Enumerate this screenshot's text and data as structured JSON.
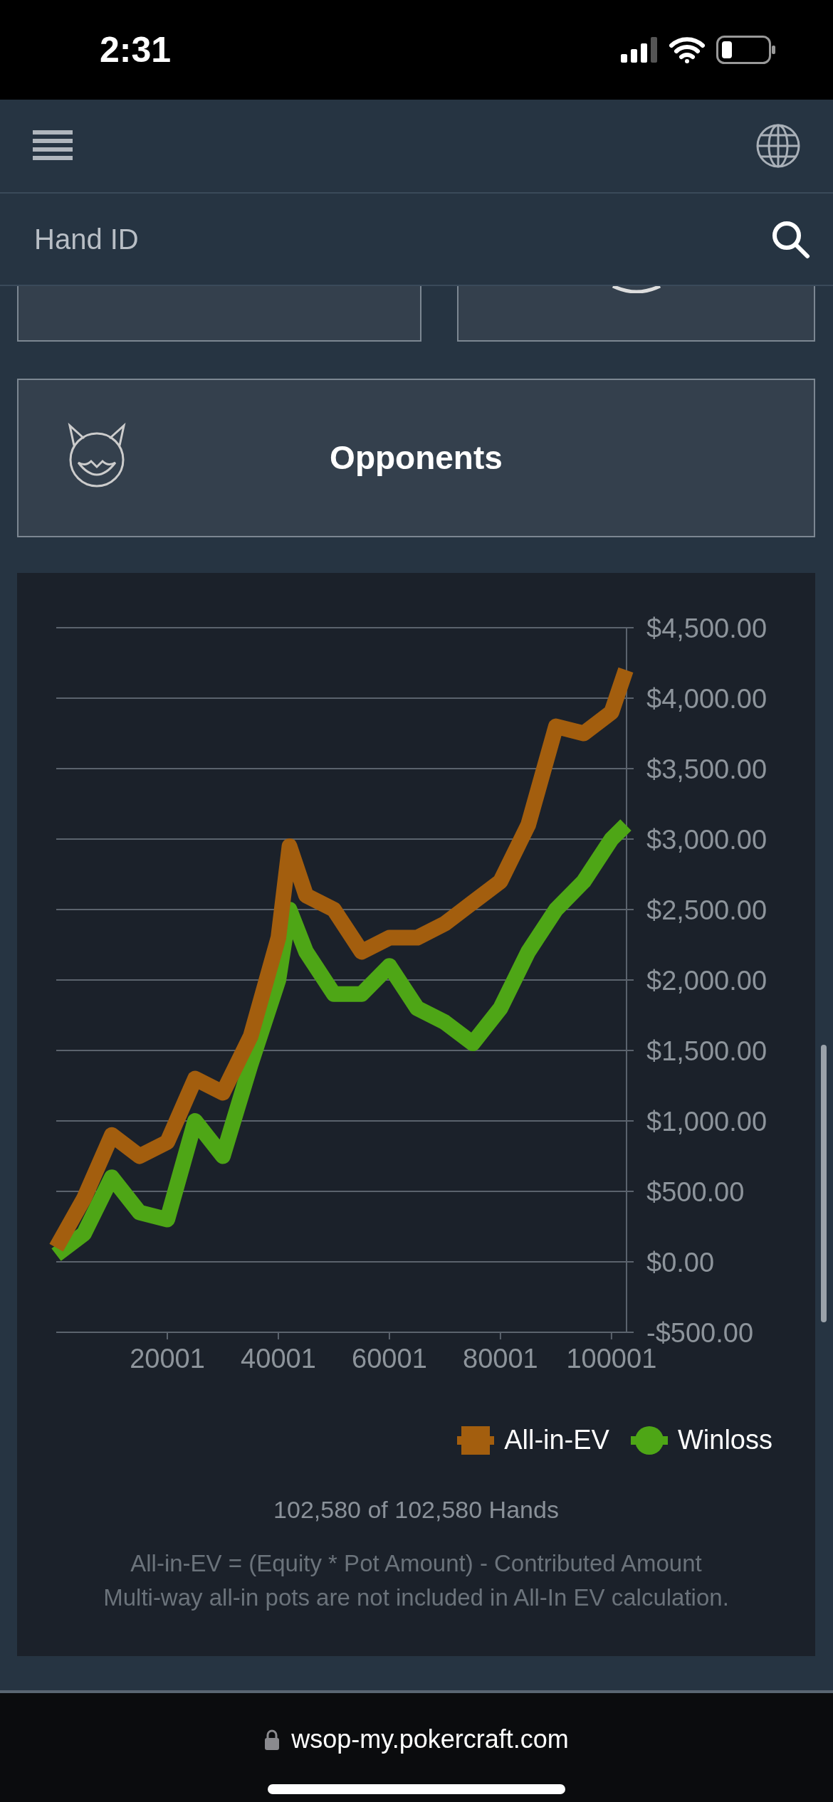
{
  "status_bar": {
    "time": "2:31"
  },
  "search": {
    "placeholder": "Hand ID"
  },
  "opponents_card": {
    "label": "Opponents"
  },
  "chart": {
    "chart_data": {
      "type": "line",
      "x": [
        1,
        5001,
        10001,
        15001,
        20001,
        25001,
        30001,
        35001,
        40001,
        42001,
        45001,
        50001,
        55001,
        60001,
        65001,
        70001,
        75001,
        80001,
        85001,
        90001,
        95001,
        100001,
        102580
      ],
      "series": [
        {
          "name": "All-in-EV",
          "color": "#a35e0e",
          "values": [
            100,
            450,
            900,
            750,
            850,
            1300,
            1200,
            1600,
            2300,
            2950,
            2600,
            2500,
            2200,
            2300,
            2300,
            2400,
            2550,
            2700,
            3100,
            3800,
            3750,
            3900,
            4200
          ]
        },
        {
          "name": "Winloss",
          "color": "#4ea616",
          "values": [
            50,
            200,
            600,
            350,
            300,
            1000,
            750,
            1400,
            2000,
            2500,
            2200,
            1900,
            1900,
            2100,
            1800,
            1700,
            1550,
            1800,
            2200,
            2500,
            2700,
            3000,
            3100
          ]
        }
      ],
      "xlim": [
        1,
        102580
      ],
      "ylim": [
        -500,
        4500
      ],
      "grid": true,
      "yticks": [
        {
          "value": 4500,
          "label": "$4,500.00"
        },
        {
          "value": 4000,
          "label": "$4,000.00"
        },
        {
          "value": 3500,
          "label": "$3,500.00"
        },
        {
          "value": 3000,
          "label": "$3,000.00"
        },
        {
          "value": 2500,
          "label": "$2,500.00"
        },
        {
          "value": 2000,
          "label": "$2,000.00"
        },
        {
          "value": 1500,
          "label": "$1,500.00"
        },
        {
          "value": 1000,
          "label": "$1,000.00"
        },
        {
          "value": 500,
          "label": "$500.00"
        },
        {
          "value": 0,
          "label": "$0.00"
        },
        {
          "value": -500,
          "label": "-$500.00"
        }
      ],
      "xticks": [
        20001,
        40001,
        60001,
        80001,
        100001
      ]
    },
    "hands_count": "102,580 of 102,580 Hands",
    "notes": [
      "All-in-EV = (Equity * Pot Amount) - Contributed Amount",
      "Multi-way all-in pots are not included in All-In EV calculation."
    ]
  },
  "browser_bar": {
    "url": "wsop-my.pokercraft.com"
  }
}
